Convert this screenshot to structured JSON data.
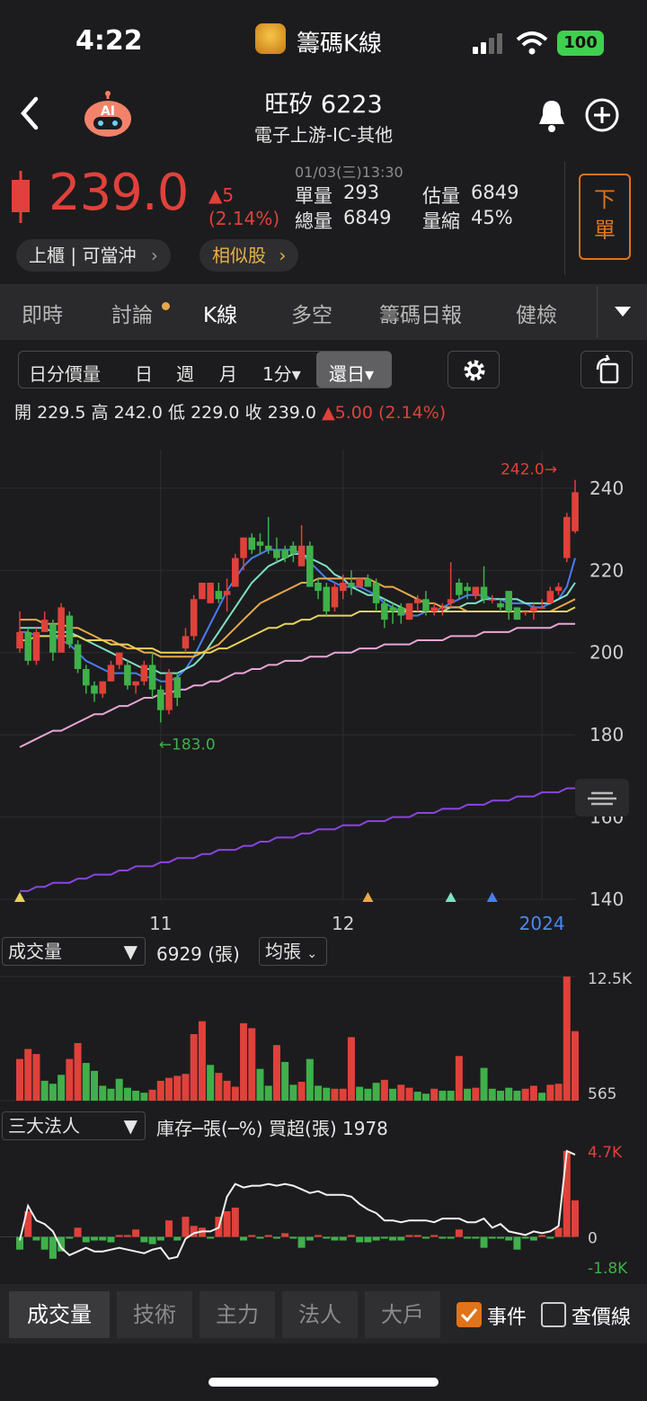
{
  "status_bar": {
    "time": "4:22",
    "app_name": "籌碼K線",
    "battery": "100"
  },
  "header": {
    "title": "旺矽 6223",
    "subtitle": "電子上游-IC-其他",
    "ai_badge": "AI"
  },
  "quote": {
    "price": "239.0",
    "change": "▲5",
    "change_pct": "(2.14%)",
    "datetime": "01/03(三)13:30",
    "single_volume_label": "單量",
    "single_volume": "293",
    "total_volume_label": "總量",
    "total_volume": "6849",
    "est_volume_label": "估量",
    "est_volume": "6849",
    "volume_shrink_label": "量縮",
    "volume_shrink": "45%",
    "market_pill": "上櫃 | 可當沖",
    "similar_pill": "相似股",
    "order_button": "下單"
  },
  "tabs": [
    "即時",
    "討論",
    "K線",
    "多空",
    "籌碼日報",
    "健檢"
  ],
  "active_tab": "K線",
  "toolbar": {
    "items": [
      "日分價量",
      "日",
      "週",
      "月",
      "1分▾"
    ],
    "active": "還日▾"
  },
  "ohlc": {
    "open_label": "開",
    "open": "229.5",
    "high_label": "高",
    "high": "242.0",
    "low_label": "低",
    "low": "229.0",
    "close_label": "收",
    "close": "239.0",
    "change": "▲5.00 (2.14%)"
  },
  "volume_panel": {
    "selector": "成交量",
    "value": "6929 (張)",
    "mode": "均張",
    "max_label": "12.5K",
    "min_label": "565"
  },
  "inst_panel": {
    "selector": "三大法人",
    "info": "庫存─張(─%)  買超(張) 1978",
    "max_label": "4.7K",
    "zero_label": "0",
    "min_label": "-1.8K"
  },
  "bottom_tabs": [
    "成交量",
    "技術",
    "主力",
    "法人",
    "大戶"
  ],
  "checkboxes": [
    {
      "label": "事件",
      "checked": true
    },
    {
      "label": "查價線",
      "checked": false
    }
  ],
  "colors": {
    "up": "#e0413a",
    "down": "#3fb04a",
    "accent": "#e0741a",
    "bg": "#1c1c1e"
  },
  "chart_data": [
    {
      "type": "candlestick",
      "y_ticks": [
        "240",
        "220",
        "200",
        "180",
        "160",
        "140"
      ],
      "ylim": [
        140,
        245
      ],
      "x_ticks": [
        "11",
        "12",
        "2024"
      ],
      "annotations": {
        "high": "242.0→",
        "low": "←183.0"
      },
      "candles": [
        [
          201,
          210,
          200,
          205
        ],
        [
          205,
          206,
          197,
          198
        ],
        [
          198,
          206,
          197,
          205
        ],
        [
          205,
          210,
          205,
          208
        ],
        [
          207,
          208,
          198,
          200
        ],
        [
          200,
          212,
          200,
          211
        ],
        [
          209,
          210,
          201,
          202
        ],
        [
          202,
          203,
          195,
          196
        ],
        [
          196,
          197,
          190,
          192
        ],
        [
          192,
          193,
          188,
          190
        ],
        [
          190,
          193,
          189,
          193
        ],
        [
          193,
          198,
          193,
          197
        ],
        [
          197,
          200,
          196,
          200
        ],
        [
          197,
          198,
          191,
          192
        ],
        [
          192,
          193,
          190,
          193
        ],
        [
          193,
          198,
          192,
          197
        ],
        [
          197,
          200,
          189,
          191
        ],
        [
          191,
          192,
          183,
          186
        ],
        [
          186,
          196,
          185,
          195
        ],
        [
          194,
          195,
          187,
          189
        ],
        [
          201,
          206,
          200,
          204
        ],
        [
          204,
          214,
          203,
          213
        ],
        [
          213,
          217,
          213,
          217
        ],
        [
          212,
          217,
          212,
          217
        ],
        [
          215,
          217,
          212,
          213
        ],
        [
          214,
          218,
          210,
          215
        ],
        [
          216,
          224,
          216,
          223
        ],
        [
          223,
          228,
          220,
          228
        ],
        [
          228,
          229,
          224,
          225
        ],
        [
          227,
          229,
          224,
          226
        ],
        [
          226,
          233,
          224,
          225
        ],
        [
          225,
          228,
          222,
          223
        ],
        [
          225,
          226,
          222,
          223
        ],
        [
          226,
          227,
          222,
          224
        ],
        [
          221,
          231,
          221,
          226
        ],
        [
          226,
          227,
          216,
          216
        ],
        [
          217,
          218,
          213,
          215
        ],
        [
          216,
          217,
          209,
          210
        ],
        [
          211,
          217,
          210,
          216
        ],
        [
          215,
          219,
          213,
          217
        ],
        [
          217,
          220,
          214,
          216
        ],
        [
          216,
          218,
          216,
          218
        ],
        [
          218,
          219,
          216,
          216
        ],
        [
          217,
          218,
          210,
          212
        ],
        [
          212,
          213,
          206,
          208
        ],
        [
          211,
          212,
          207,
          210
        ],
        [
          211,
          212,
          207,
          209
        ],
        [
          208,
          212,
          208,
          212
        ],
        [
          212,
          214,
          210,
          213
        ],
        [
          213,
          215,
          209,
          210
        ],
        [
          210,
          212,
          209,
          211
        ],
        [
          211,
          212,
          209,
          211
        ],
        [
          212,
          222,
          211,
          213
        ],
        [
          217,
          218,
          213,
          214
        ],
        [
          216,
          217,
          213,
          215
        ],
        [
          214,
          216,
          213,
          216
        ],
        [
          216,
          221,
          212,
          213
        ],
        [
          213,
          214,
          212,
          213
        ],
        [
          212,
          213,
          210,
          211
        ],
        [
          215,
          215,
          208,
          210
        ],
        [
          211,
          211,
          208,
          208
        ],
        [
          210,
          210,
          209,
          210
        ],
        [
          210,
          212,
          208,
          211
        ],
        [
          211,
          213,
          211,
          211
        ],
        [
          212,
          216,
          212,
          215
        ],
        [
          215,
          217,
          214,
          216
        ],
        [
          223,
          234,
          222,
          233
        ],
        [
          229.5,
          242,
          229,
          239
        ]
      ],
      "ma_lines": [
        {
          "color": "#4a7df0",
          "values": [
            205,
            205,
            204,
            204,
            204,
            203,
            202,
            200,
            198,
            197,
            196,
            195,
            195,
            195,
            195,
            194,
            194,
            193,
            193,
            194,
            196,
            199,
            203,
            207,
            211,
            215,
            218,
            221,
            223,
            224,
            225,
            225,
            225,
            225,
            224,
            222,
            220,
            218,
            217,
            216,
            216,
            216,
            215,
            214,
            212,
            211,
            210,
            209,
            209,
            210,
            210,
            211,
            212,
            213,
            214,
            214,
            214,
            213,
            213,
            212,
            212,
            212,
            211,
            211,
            212,
            213,
            216,
            223
          ]
        },
        {
          "color": "#7fe0c4",
          "values": [
            206,
            206,
            206,
            206,
            205,
            205,
            205,
            204,
            203,
            202,
            201,
            200,
            199,
            198,
            197,
            196,
            196,
            195,
            195,
            195,
            196,
            197,
            199,
            202,
            205,
            208,
            211,
            214,
            217,
            219,
            221,
            222,
            223,
            224,
            224,
            223,
            222,
            221,
            219,
            218,
            216,
            215,
            214,
            214,
            213,
            212,
            211,
            210,
            210,
            210,
            210,
            210,
            211,
            211,
            212,
            212,
            213,
            213,
            213,
            213,
            213,
            212,
            212,
            212,
            212,
            213,
            214,
            217
          ]
        },
        {
          "color": "#e8a84c",
          "values": [
            208,
            208,
            208,
            207,
            207,
            207,
            206,
            206,
            205,
            204,
            203,
            203,
            202,
            201,
            201,
            200,
            200,
            199,
            199,
            199,
            199,
            199,
            200,
            201,
            202,
            204,
            206,
            208,
            210,
            212,
            213,
            214,
            215,
            216,
            217,
            217,
            218,
            218,
            218,
            218,
            218,
            218,
            218,
            217,
            216,
            216,
            215,
            214,
            213,
            212,
            212,
            211,
            211,
            211,
            210,
            210,
            210,
            210,
            210,
            210,
            210,
            210,
            210,
            210,
            210,
            211,
            212,
            213
          ]
        },
        {
          "color": "#e6d45a",
          "values": [
            203,
            203,
            204,
            204,
            204,
            204,
            204,
            204,
            203,
            203,
            203,
            202,
            202,
            202,
            201,
            201,
            201,
            200,
            200,
            200,
            200,
            200,
            200,
            200,
            201,
            201,
            202,
            203,
            204,
            205,
            206,
            206,
            207,
            207,
            208,
            208,
            209,
            209,
            209,
            209,
            209,
            210,
            210,
            210,
            210,
            210,
            210,
            210,
            210,
            210,
            210,
            210,
            210,
            210,
            210,
            210,
            210,
            210,
            210,
            210,
            210,
            210,
            210,
            210,
            210,
            210,
            210,
            211
          ]
        },
        {
          "color": "#e8a6d6",
          "values": [
            177,
            178,
            179,
            180,
            181,
            181,
            182,
            183,
            184,
            185,
            185,
            186,
            187,
            187,
            188,
            189,
            189,
            190,
            190,
            191,
            191,
            192,
            192,
            193,
            193,
            194,
            195,
            195,
            196,
            196,
            197,
            197,
            198,
            198,
            198,
            199,
            199,
            199,
            200,
            200,
            200,
            201,
            201,
            201,
            202,
            202,
            202,
            202,
            203,
            203,
            203,
            203,
            204,
            204,
            204,
            204,
            205,
            205,
            205,
            205,
            206,
            206,
            206,
            206,
            206,
            207,
            207,
            207
          ]
        },
        {
          "color": "#8a44e0",
          "values": [
            142,
            142,
            143,
            143,
            144,
            144,
            144,
            145,
            145,
            146,
            146,
            146,
            147,
            147,
            148,
            148,
            148,
            149,
            149,
            150,
            150,
            150,
            151,
            151,
            152,
            152,
            152,
            153,
            153,
            154,
            154,
            155,
            155,
            155,
            156,
            156,
            157,
            157,
            157,
            158,
            158,
            158,
            159,
            159,
            159,
            160,
            160,
            160,
            161,
            161,
            161,
            162,
            162,
            162,
            163,
            163,
            163,
            164,
            164,
            164,
            165,
            165,
            165,
            166,
            166,
            166,
            167,
            167
          ]
        }
      ],
      "event_markers": [
        {
          "index": 0,
          "color": "#e6d45a"
        },
        {
          "index": 42,
          "color": "#e8a84c"
        },
        {
          "index": 52,
          "color": "#7fe0c4"
        },
        {
          "index": 57,
          "color": "#4a7df0"
        }
      ]
    },
    {
      "type": "bar",
      "title": "成交量",
      "values": [
        4200,
        5200,
        4700,
        2000,
        1700,
        2600,
        4200,
        5800,
        3800,
        3000,
        1500,
        1200,
        2200,
        1300,
        1000,
        800,
        1100,
        2000,
        2300,
        2500,
        2700,
        6700,
        8000,
        3600,
        2800,
        2000,
        1400,
        7800,
        7300,
        3200,
        1500,
        5600,
        3900,
        1600,
        1900,
        4200,
        1500,
        1300,
        1200,
        1200,
        6400,
        1400,
        1200,
        1800,
        2100,
        1200,
        1600,
        1300,
        900,
        700,
        1200,
        1000,
        1000,
        4500,
        1200,
        1300,
        3300,
        1200,
        1000,
        1300,
        1000,
        1200,
        1500,
        800,
        1600,
        1700,
        12500,
        7000
      ],
      "up": [
        true,
        true,
        true,
        false,
        false,
        false,
        true,
        true,
        false,
        false,
        false,
        false,
        false,
        false,
        false,
        false,
        true,
        true,
        true,
        true,
        true,
        true,
        true,
        false,
        true,
        true,
        true,
        true,
        true,
        false,
        false,
        true,
        false,
        false,
        true,
        false,
        false,
        false,
        true,
        true,
        true,
        false,
        false,
        false,
        true,
        false,
        true,
        true,
        false,
        false,
        true,
        false,
        false,
        true,
        false,
        true,
        false,
        false,
        false,
        false,
        false,
        true,
        true,
        false,
        true,
        true,
        true,
        true
      ],
      "ylim": [
        0,
        12500
      ]
    },
    {
      "type": "bar",
      "title": "三大法人",
      "values": [
        -700,
        1400,
        -200,
        -700,
        -1200,
        -800,
        -100,
        500,
        -300,
        -200,
        -200,
        -300,
        100,
        100,
        400,
        -300,
        -400,
        -200,
        900,
        -200,
        1100,
        600,
        500,
        -100,
        1100,
        1400,
        1600,
        -200,
        100,
        -100,
        100,
        -100,
        200,
        -100,
        -600,
        -200,
        100,
        -100,
        -200,
        -200,
        100,
        -300,
        -300,
        -200,
        -100,
        -200,
        -200,
        100,
        100,
        -100,
        100,
        -100,
        -100,
        400,
        -100,
        -100,
        -600,
        -100,
        -100,
        -200,
        -700,
        -100,
        -200,
        100,
        -100,
        500,
        4700,
        2000
      ],
      "line": [
        -200,
        1700,
        900,
        700,
        300,
        -600,
        -1000,
        -800,
        -600,
        -800,
        -800,
        -700,
        -600,
        -700,
        -800,
        -900,
        -700,
        -600,
        -1200,
        -1100,
        -100,
        200,
        300,
        300,
        500,
        2200,
        2900,
        2700,
        2800,
        2800,
        2900,
        2800,
        2900,
        2800,
        2600,
        2400,
        2500,
        2300,
        2300,
        2300,
        2200,
        1800,
        1500,
        1300,
        900,
        900,
        800,
        900,
        900,
        900,
        800,
        1000,
        1000,
        1000,
        800,
        800,
        1000,
        500,
        700,
        300,
        200,
        100,
        300,
        200,
        300,
        600,
        4700,
        4500
      ],
      "ylim": [
        -1800,
        4700
      ]
    }
  ]
}
